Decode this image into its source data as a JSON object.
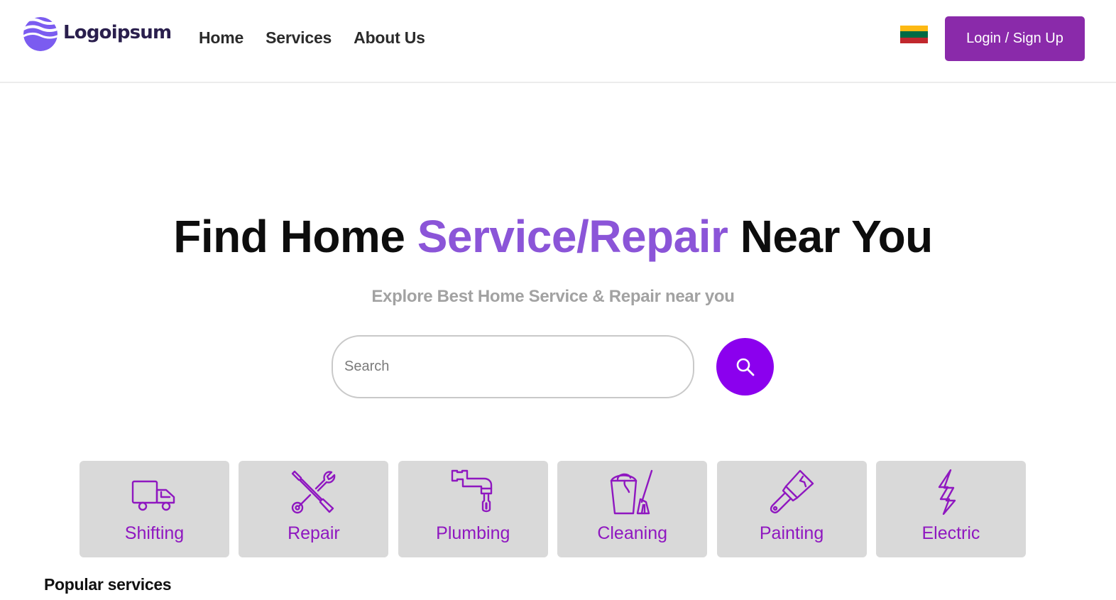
{
  "brand": {
    "name": "Logoipsum",
    "logo_icon": "logo-waves-icon",
    "color": "#7b5cf0"
  },
  "nav": {
    "items": [
      {
        "label": "Home"
      },
      {
        "label": "Services"
      },
      {
        "label": "About Us"
      }
    ]
  },
  "language_flag": {
    "icon": "lithuania-flag-icon",
    "colors": [
      "#fdb913",
      "#006a44",
      "#c1272d"
    ]
  },
  "auth": {
    "login_label": "Login / Sign Up",
    "color": "#8a2aaa"
  },
  "hero": {
    "title_before": "Find Home ",
    "title_accent": "Service/Repair",
    "title_after": " Near You",
    "accent_color": "#8b55d8",
    "subtitle": "Explore Best Home Service & Repair near you"
  },
  "search": {
    "placeholder": "Search",
    "value": "",
    "button_icon": "search-icon",
    "button_color": "#8b00ee"
  },
  "categories": [
    {
      "label": "Shifting",
      "icon": "truck-icon"
    },
    {
      "label": "Repair",
      "icon": "tools-icon"
    },
    {
      "label": "Plumbing",
      "icon": "faucet-icon"
    },
    {
      "label": "Cleaning",
      "icon": "bucket-broom-icon"
    },
    {
      "label": "Painting",
      "icon": "paint-brush-icon"
    },
    {
      "label": "Electric",
      "icon": "lightning-icon"
    }
  ],
  "category_color": "#8f17c0",
  "popular": {
    "heading": "Popular services"
  }
}
